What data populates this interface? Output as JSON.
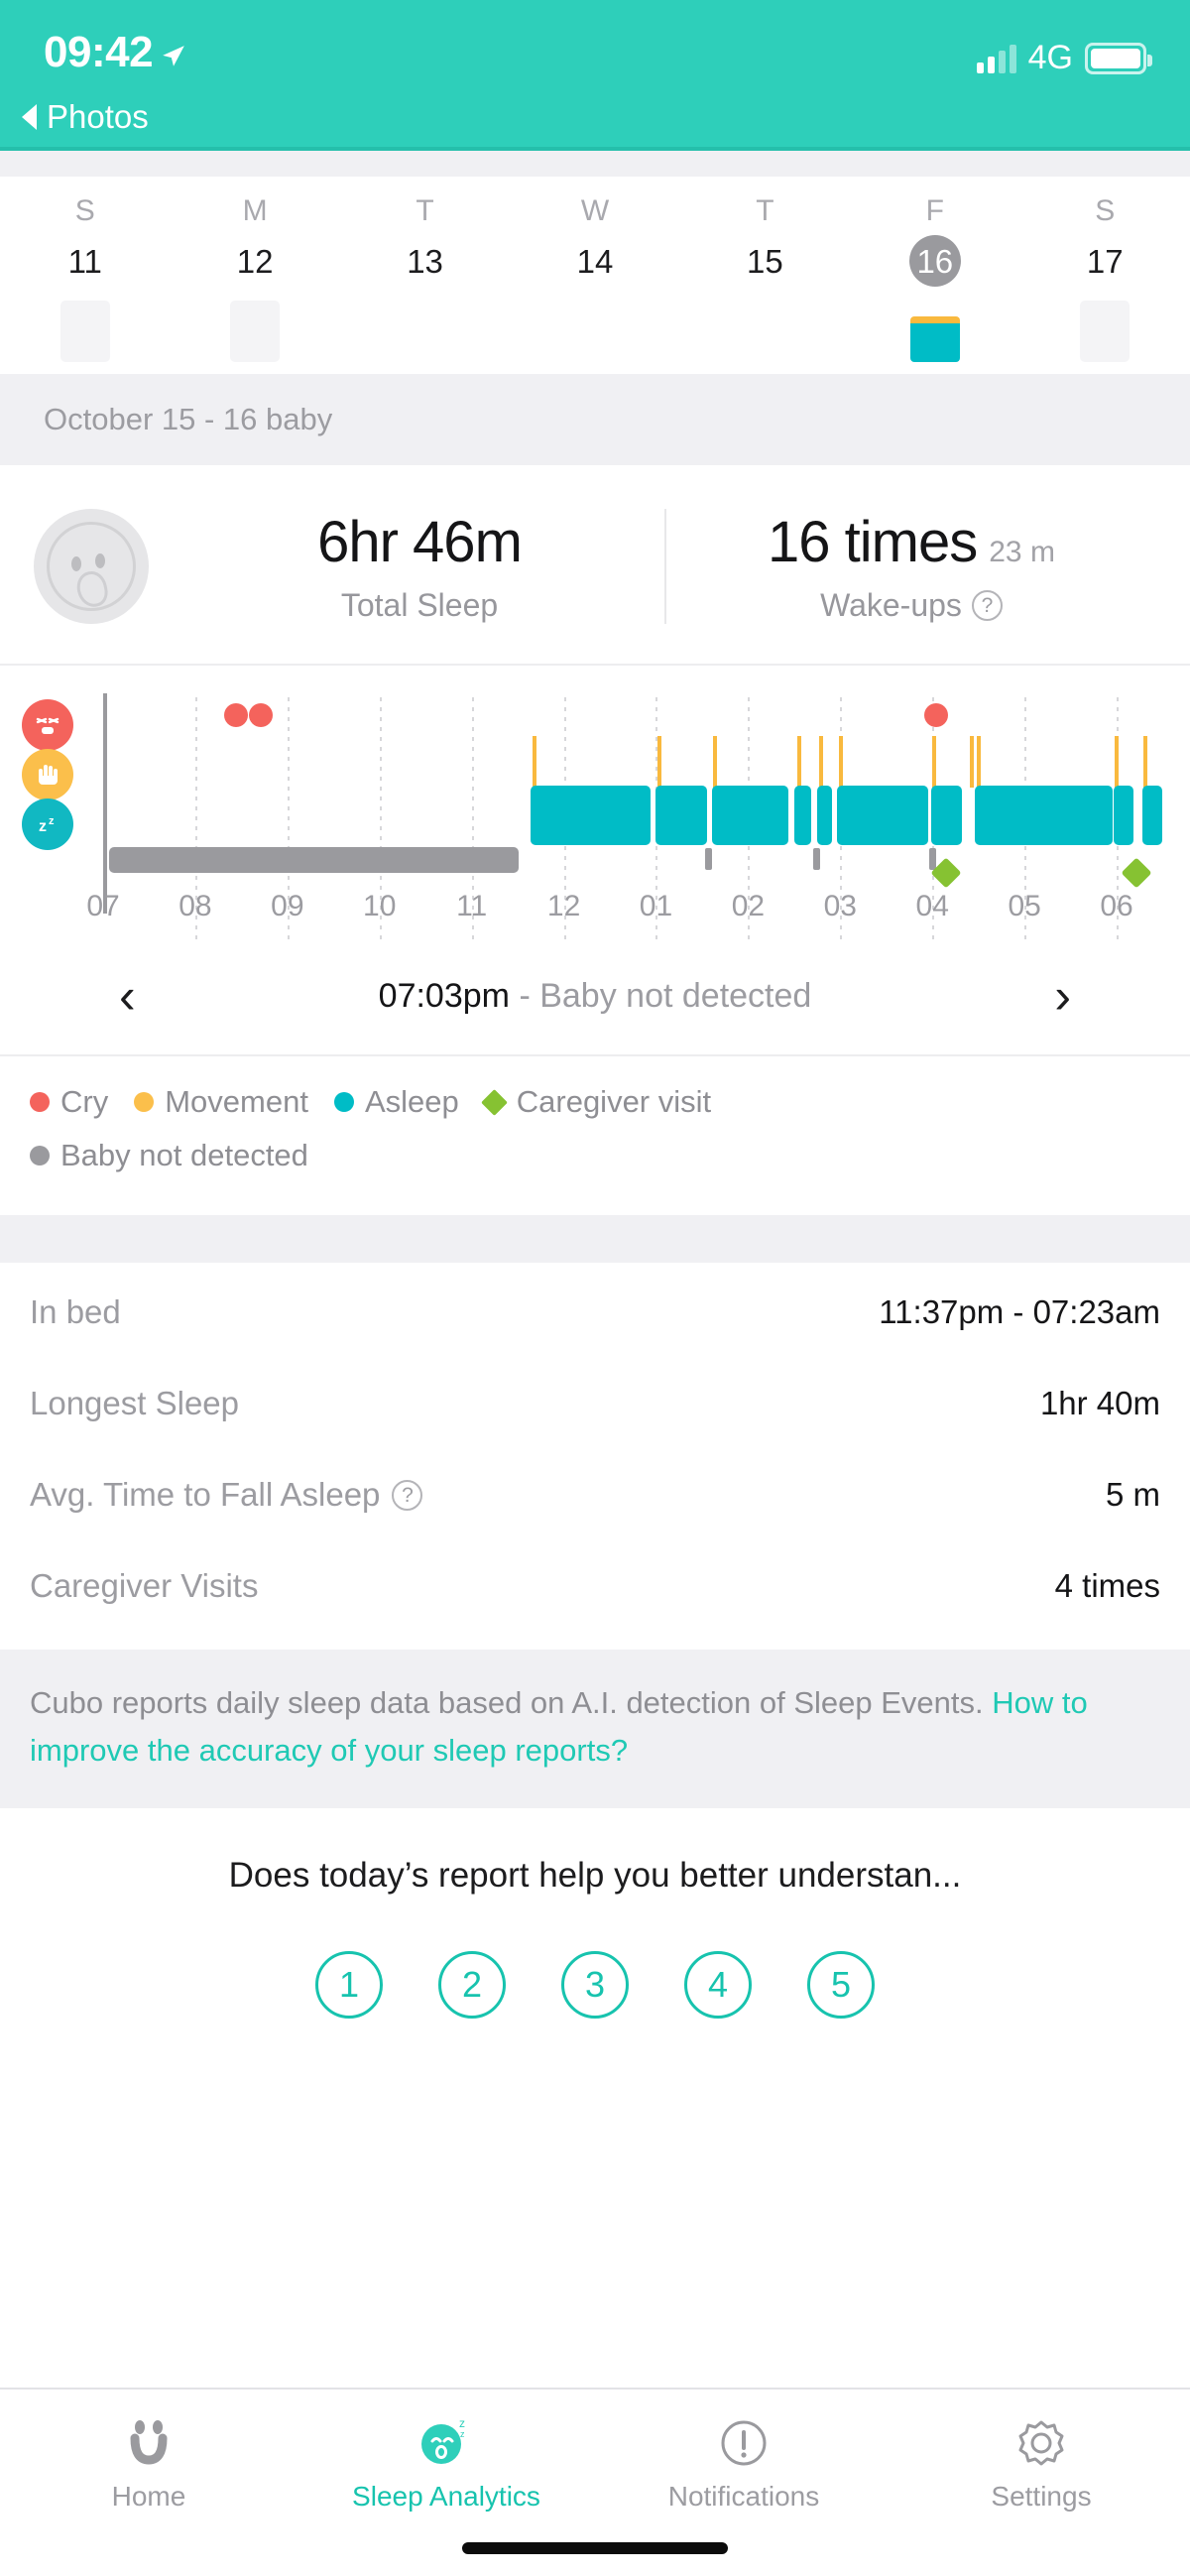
{
  "status_bar": {
    "time": "09:42",
    "location_icon": "location-arrow-icon",
    "network": "4G",
    "signal_icon": "signal-bars-icon",
    "battery_icon": "battery-full-icon"
  },
  "back_nav": {
    "label": "Photos",
    "icon": "back-triangle-icon"
  },
  "calendar": {
    "days": [
      {
        "dow": "S",
        "num": "11",
        "selected": false,
        "bar": "empty"
      },
      {
        "dow": "M",
        "num": "12",
        "selected": false,
        "bar": "empty"
      },
      {
        "dow": "T",
        "num": "13",
        "selected": false,
        "bar": "none"
      },
      {
        "dow": "W",
        "num": "14",
        "selected": false,
        "bar": "none"
      },
      {
        "dow": "T",
        "num": "15",
        "selected": false,
        "bar": "none"
      },
      {
        "dow": "F",
        "num": "16",
        "selected": true,
        "bar": "data"
      },
      {
        "dow": "S",
        "num": "17",
        "selected": false,
        "bar": "empty"
      }
    ]
  },
  "date_range": "October 15 - 16 baby",
  "summary": {
    "avatar_icon": "baby-face-icon",
    "total_sleep": {
      "value": "6hr 46m",
      "label": "Total Sleep"
    },
    "wakeups": {
      "value": "16 times",
      "sub": "23 m",
      "label": "Wake-ups",
      "help_icon": "question-mark-icon"
    }
  },
  "chart_legend_icons": [
    {
      "name": "cry-icon",
      "color": "#F4635C",
      "glyph": "✖"
    },
    {
      "name": "movement-hand-icon",
      "color": "#FBBF4B",
      "glyph": "✋"
    },
    {
      "name": "asleep-zzz-icon",
      "color": "#11B8C2",
      "glyph": "z"
    }
  ],
  "time_nav": {
    "prev_icon": "chevron-left-icon",
    "next_icon": "chevron-right-icon",
    "time": "07:03pm",
    "separator": " - ",
    "status": "Baby not detected"
  },
  "legend": [
    {
      "label": "Cry",
      "color": "#F4635C",
      "shape": "dot"
    },
    {
      "label": "Movement",
      "color": "#FBBF4B",
      "shape": "dot"
    },
    {
      "label": "Asleep",
      "color": "#00BCC6",
      "shape": "dot"
    },
    {
      "label": "Caregiver visit",
      "color": "#86C232",
      "shape": "diamond"
    },
    {
      "label": "Baby not detected",
      "color": "#9A9A9E",
      "shape": "dot"
    }
  ],
  "stats": [
    {
      "label": "In bed",
      "value": "11:37pm - 07:23am",
      "help": false
    },
    {
      "label": "Longest Sleep",
      "value": "1hr 40m",
      "help": false
    },
    {
      "label": "Avg. Time to Fall Asleep",
      "value": "5 m",
      "help": true
    },
    {
      "label": "Caregiver Visits",
      "value": "4 times",
      "help": false
    }
  ],
  "note": {
    "text": "Cubo reports daily sleep data based on A.I. detection of Sleep Events. ",
    "link": "How to improve the accuracy of your sleep reports?"
  },
  "survey": {
    "question": "Does today’s report help you better understan...",
    "options": [
      "1",
      "2",
      "3",
      "4",
      "5"
    ]
  },
  "tabs": [
    {
      "label": "Home",
      "icon": "smiley-face-icon",
      "active": false
    },
    {
      "label": "Sleep Analytics",
      "icon": "sleeping-face-icon",
      "active": true
    },
    {
      "label": "Notifications",
      "icon": "exclamation-circle-icon",
      "active": false
    },
    {
      "label": "Settings",
      "icon": "gear-icon",
      "active": false
    }
  ],
  "colors": {
    "brand_teal": "#2ECFBA",
    "asleep": "#00BCC6",
    "movement": "#FBBF4B",
    "cry": "#F4635C",
    "caregiver": "#86C232",
    "not_detected": "#9A9A9E"
  },
  "chart_data": {
    "type": "timeline",
    "title": "Sleep timeline",
    "x_axis": {
      "labels": [
        "07",
        "08",
        "09",
        "10",
        "11",
        "12",
        "01",
        "02",
        "03",
        "04",
        "05",
        "06"
      ],
      "start_hour_label": "07",
      "end_hour_label": "06",
      "grid": true
    },
    "series": [
      {
        "name": "Baby not detected",
        "type": "bar",
        "color": "#9A9A9E",
        "segments": [
          {
            "start": 0.0,
            "end": 4.55
          }
        ]
      },
      {
        "name": "Asleep",
        "type": "bar",
        "color": "#00BCC6",
        "segments": [
          {
            "start": 4.72,
            "end": 6.05
          },
          {
            "start": 6.12,
            "end": 6.67
          },
          {
            "start": 6.73,
            "end": 7.55
          },
          {
            "start": 7.62,
            "end": 7.8
          },
          {
            "start": 7.87,
            "end": 8.02
          },
          {
            "start": 8.1,
            "end": 9.08
          },
          {
            "start": 9.17,
            "end": 9.5
          },
          {
            "start": 9.58,
            "end": 11.12
          },
          {
            "start": 11.2,
            "end": 11.42
          },
          {
            "start": 11.52,
            "end": 11.78
          }
        ]
      },
      {
        "name": "Movement",
        "type": "tick",
        "color": "#FBBF4B",
        "points": [
          4.72,
          6.08,
          6.7,
          7.58,
          7.83,
          8.05,
          9.12,
          9.54,
          9.6,
          11.16,
          11.48
        ]
      },
      {
        "name": "Cry",
        "type": "dot",
        "color": "#F4635C",
        "points": [
          1.38,
          1.55,
          9.1
        ]
      },
      {
        "name": "Caregiver visit",
        "type": "diamond",
        "color": "#86C232",
        "points": [
          9.25,
          11.62
        ]
      },
      {
        "name": "Not detected gaps",
        "type": "small-bar",
        "color": "#9A9A9E",
        "points": [
          6.7,
          7.86,
          9.08
        ]
      }
    ]
  }
}
